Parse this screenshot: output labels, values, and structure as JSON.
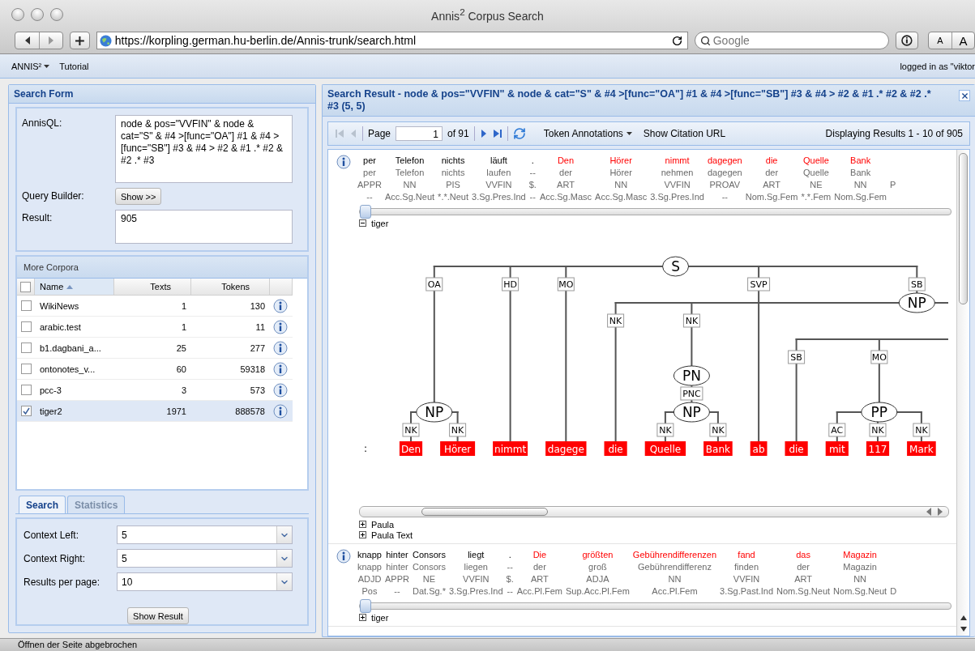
{
  "browser": {
    "title": "Annis$^{2}$ Corpus Search",
    "url": "https://korpling.german.hu-berlin.de/Annis-trunk/search.html",
    "search_placeholder": "Google",
    "font_buttons": [
      "A",
      "A"
    ]
  },
  "menu": {
    "items": [
      {
        "label": "ANNIS²",
        "kind": "dropdown"
      },
      {
        "label": "Tutorial",
        "kind": "link"
      }
    ],
    "user": "logged in as \"viktor"
  },
  "search_form": {
    "title": "Search Form",
    "query_label": "AnnisQL:",
    "query": "node & pos=\"VVFIN\" & node & cat=\"S\" & #4 >[func=\"OA\"] #1 & #4 >[func=\"SB\"] #3 & #4 > #2 & #1 .* #2 & #2 .* #3",
    "builder_label": "Query Builder:",
    "builder_button": "Show >>",
    "result_label": "Result:",
    "result": "905"
  },
  "corpora": {
    "title": "More Corpora",
    "all_checked": false,
    "columns": [
      {
        "label": "Name",
        "sorted": true
      },
      {
        "label": "Texts"
      },
      {
        "label": "Tokens"
      }
    ],
    "rows": [
      {
        "name": "WikiNews",
        "texts": "1",
        "tokens": "130",
        "checked": false
      },
      {
        "name": "arabic.test",
        "texts": "1",
        "tokens": "11",
        "checked": false
      },
      {
        "name": "b1.dagbani_a...",
        "texts": "25",
        "tokens": "277",
        "checked": false
      },
      {
        "name": "ontonotes_v...",
        "texts": "60",
        "tokens": "59318",
        "checked": false
      },
      {
        "name": "pcc-3",
        "texts": "3",
        "tokens": "573",
        "checked": false
      },
      {
        "name": "tiger2",
        "texts": "1971",
        "tokens": "888578",
        "checked": true
      }
    ]
  },
  "tabs": [
    {
      "label": "Search",
      "selected": true
    },
    {
      "label": "Statistics",
      "selected": false
    }
  ],
  "options": [
    {
      "label": "Context Left:",
      "value": "5"
    },
    {
      "label": "Context Right:",
      "value": "5"
    },
    {
      "label": "Results per page:",
      "value": "10"
    }
  ],
  "show_result": "Show Result",
  "result_panel": {
    "title": "Search Result - node & pos=\"VVFIN\" & node & cat=\"S\" & #4 >[func=\"OA\"] #1 & #4 >[func=\"SB\"] #3 & #4 > #2 & #1 .* #2 & #2 .* #3 (5, 5)",
    "paging": {
      "first_disabled": true,
      "prev_disabled": true,
      "page_label": "Page",
      "page": "1",
      "of": "of 91"
    },
    "annotations_menu": "Token Annotations",
    "citation": "Show Citation URL",
    "display": "Displaying Results 1 - 10 of 905"
  },
  "results": [
    {
      "tokens": [
        {
          "word": "per",
          "lemma": "per",
          "pos": "APPR",
          "morph": "--",
          "match": false
        },
        {
          "word": "Telefon",
          "lemma": "Telefon",
          "pos": "NN",
          "morph": "Acc.Sg.Neut",
          "match": false
        },
        {
          "word": "nichts",
          "lemma": "nichts",
          "pos": "PIS",
          "morph": "*.*.Neut",
          "match": false
        },
        {
          "word": "läuft",
          "lemma": "laufen",
          "pos": "VVFIN",
          "morph": "3.Sg.Pres.Ind",
          "match": false
        },
        {
          "word": ".",
          "lemma": "--",
          "pos": "$.",
          "morph": "--",
          "match": false
        },
        {
          "word": "Den",
          "lemma": "der",
          "pos": "ART",
          "morph": "Acc.Sg.Masc",
          "match": true
        },
        {
          "word": "Hörer",
          "lemma": "Hörer",
          "pos": "NN",
          "morph": "Acc.Sg.Masc",
          "match": true
        },
        {
          "word": "nimmt",
          "lemma": "nehmen",
          "pos": "VVFIN",
          "morph": "3.Sg.Pres.Ind",
          "match": true
        },
        {
          "word": "dagegen",
          "lemma": "dagegen",
          "pos": "PROAV",
          "morph": "--",
          "match": true
        },
        {
          "word": "die",
          "lemma": "der",
          "pos": "ART",
          "morph": "Nom.Sg.Fem",
          "match": true
        },
        {
          "word": "Quelle",
          "lemma": "Quelle",
          "pos": "NE",
          "morph": "*.*.Fem",
          "match": true
        },
        {
          "word": "Bank",
          "lemma": "Bank",
          "pos": "NN",
          "morph": "Nom.Sg.Fem",
          "match": true
        },
        {
          "pos": "P"
        }
      ],
      "layers": [
        {
          "label": "tiger",
          "expanded": true,
          "tree": {
            "prefix": ":",
            "roots": [
              {
                "label": "S",
                "children": [
                  {
                    "edge": "OA",
                    "label": "NP",
                    "children": [
                      {
                        "edge": "NK",
                        "token": "Den"
                      },
                      {
                        "edge": "NK",
                        "token": "Hörer"
                      }
                    ]
                  },
                  {
                    "edge": "HD",
                    "token": "nimmt"
                  },
                  {
                    "edge": "MO",
                    "token": "dagege"
                  },
                  {
                    "edge": "SVP",
                    "token": "ab",
                    "crosses_next": true
                  },
                  {
                    "edge": "SB",
                    "label": "NP",
                    "children": [
                      {
                        "edge": "NK",
                        "token": "die"
                      },
                      {
                        "edge": "NK",
                        "label": "PN",
                        "children": [
                          {
                            "edge": "PNC",
                            "label": "NP",
                            "children": [
                              {
                                "edge": "NK",
                                "token": "Quelle"
                              },
                              {
                                "edge": "NK",
                                "token": "Bank"
                              }
                            ]
                          }
                        ]
                      },
                      {
                        "kind": "offscreen"
                      }
                    ]
                  }
                ]
              },
              {
                "kind": "offscreen",
                "children": [
                  {
                    "edge": "SB",
                    "token": "die"
                  },
                  {
                    "edge": "MO",
                    "label": "PP",
                    "children": [
                      {
                        "edge": "AC",
                        "token": "mit"
                      },
                      {
                        "edge": "NK",
                        "token": "117"
                      },
                      {
                        "edge": "NK",
                        "token": "Mark"
                      }
                    ]
                  }
                ]
              }
            ]
          }
        },
        {
          "label": "Paula",
          "expanded": false
        },
        {
          "label": "Paula Text",
          "expanded": false
        }
      ]
    },
    {
      "tokens": [
        {
          "word": "knapp",
          "lemma": "knapp",
          "pos": "ADJD",
          "morph": "Pos",
          "match": false
        },
        {
          "word": "hinter",
          "lemma": "hinter",
          "pos": "APPR",
          "morph": "--",
          "match": false
        },
        {
          "word": "Consors",
          "lemma": "Consors",
          "pos": "NE",
          "morph": "Dat.Sg.*",
          "match": false
        },
        {
          "word": "liegt",
          "lemma": "liegen",
          "pos": "VVFIN",
          "morph": "3.Sg.Pres.Ind",
          "match": false
        },
        {
          "word": ".",
          "lemma": "--",
          "pos": "$.",
          "morph": "--",
          "match": false
        },
        {
          "word": "Die",
          "lemma": "der",
          "pos": "ART",
          "morph": "Acc.Pl.Fem",
          "match": true
        },
        {
          "word": "größten",
          "lemma": "groß",
          "pos": "ADJA",
          "morph": "Sup.Acc.Pl.Fem",
          "match": true
        },
        {
          "word": "Gebührendifferenzen",
          "lemma": "Gebührendifferenz",
          "pos": "NN",
          "morph": "Acc.Pl.Fem",
          "match": true
        },
        {
          "word": "fand",
          "lemma": "finden",
          "pos": "VVFIN",
          "morph": "3.Sg.Past.Ind",
          "match": true
        },
        {
          "word": "das",
          "lemma": "der",
          "pos": "ART",
          "morph": "Nom.Sg.Neut",
          "match": true
        },
        {
          "word": "Magazin",
          "lemma": "Magazin",
          "pos": "NN",
          "morph": "Nom.Sg.Neut",
          "match": true
        },
        {
          "morph": "D"
        }
      ],
      "layers": [
        {
          "label": "tiger",
          "expanded": false
        }
      ]
    }
  ],
  "status": "Öffnen der Seite abgebrochen"
}
